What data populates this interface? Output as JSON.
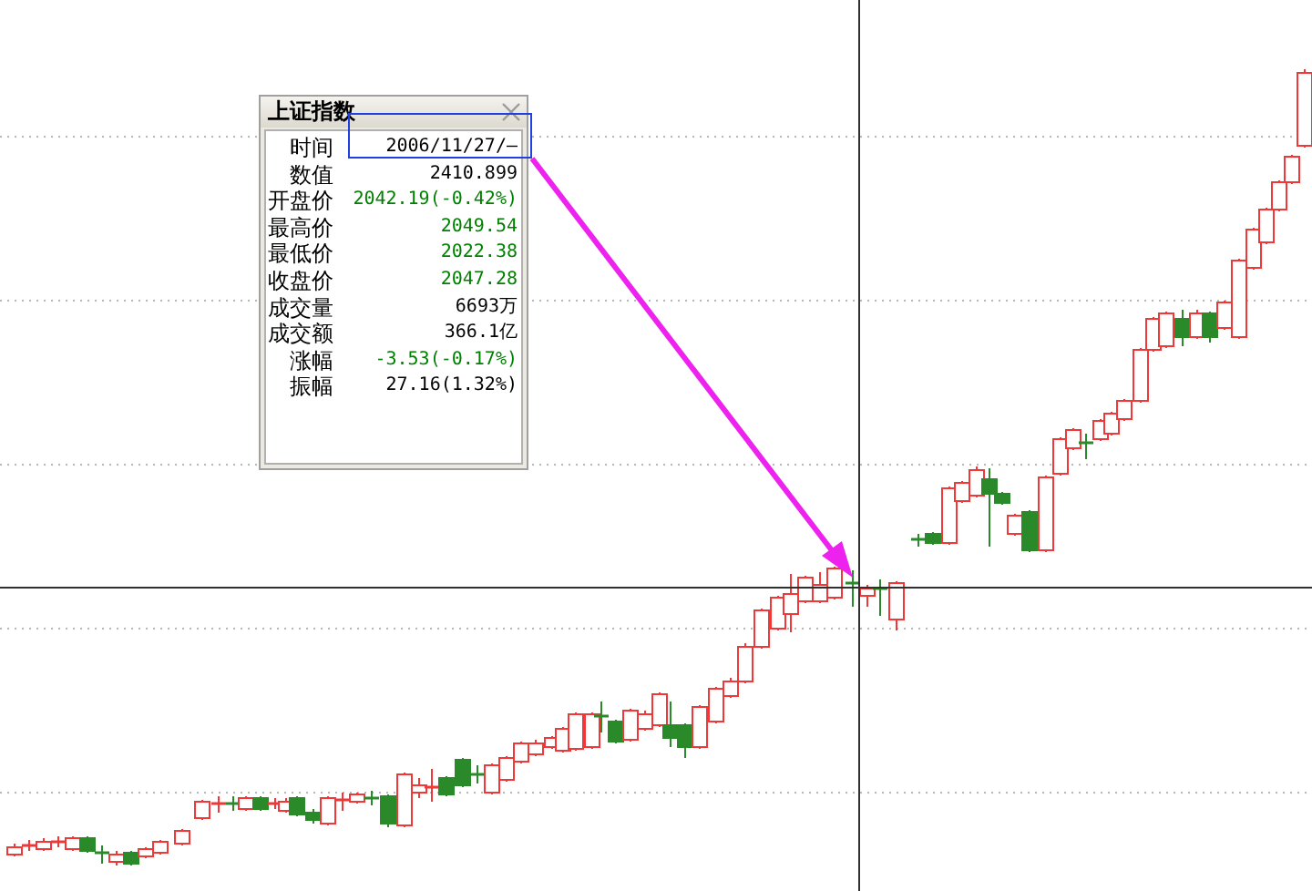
{
  "info_panel": {
    "title": "上证指数",
    "rows": [
      {
        "label": "时间",
        "value": "2006/11/27/—",
        "color": "#000000"
      },
      {
        "label": "数值",
        "value": "2410.899",
        "color": "#000000"
      },
      {
        "label": "开盘价",
        "value": "2042.19(-0.42%)",
        "color": "#008000"
      },
      {
        "label": "最高价",
        "value": "2049.54",
        "color": "#008000"
      },
      {
        "label": "最低价",
        "value": "2022.38",
        "color": "#008000"
      },
      {
        "label": "收盘价",
        "value": "2047.28",
        "color": "#008000"
      },
      {
        "label": "成交量",
        "value": "6693万",
        "color": "#000000"
      },
      {
        "label": "成交额",
        "value": "366.1亿",
        "color": "#000000"
      },
      {
        "label": "涨幅",
        "value": "-3.53(-0.17%)",
        "color": "#008000"
      },
      {
        "label": "振幅",
        "value": "27.16(1.32%)",
        "color": "#000000"
      }
    ]
  }
}
